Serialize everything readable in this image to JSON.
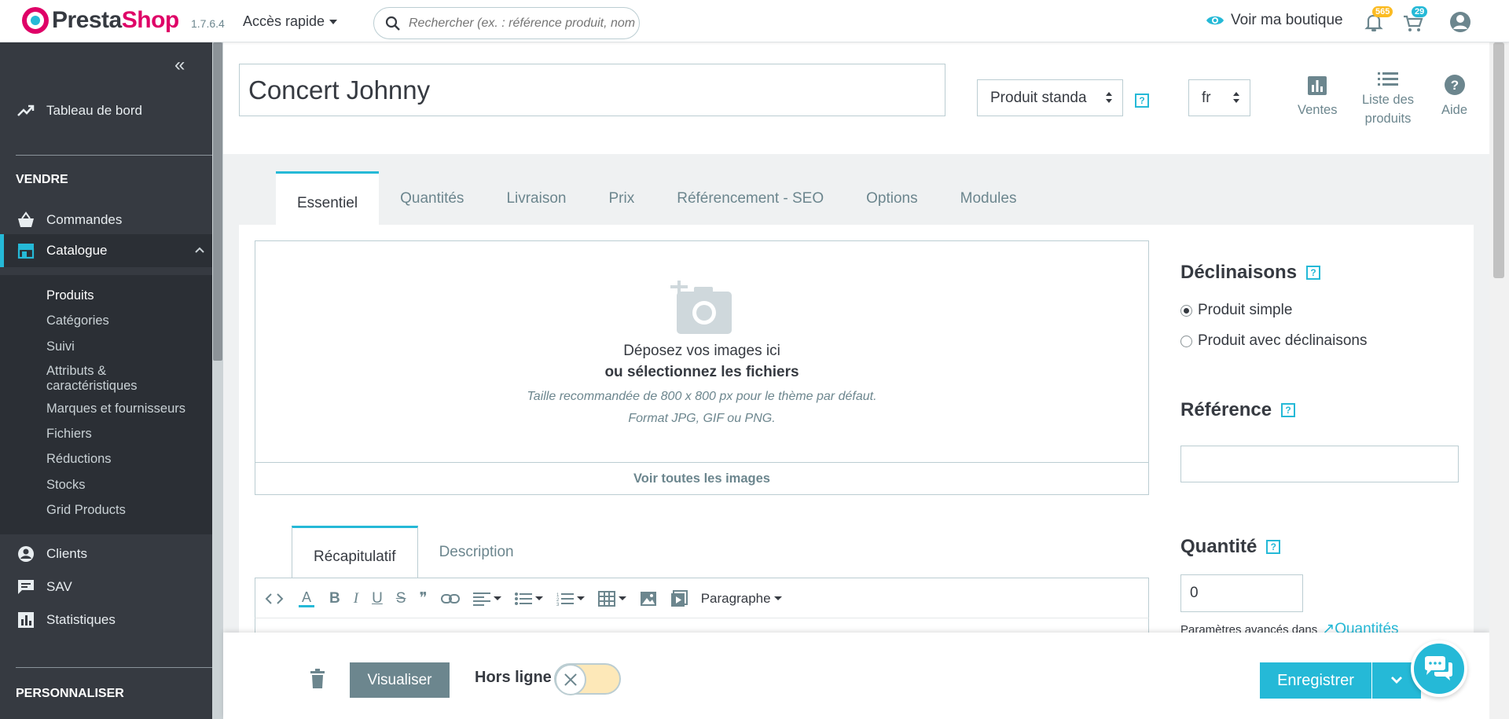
{
  "header": {
    "brand_pre": "Presta",
    "brand_post": "Shop",
    "version": "1.7.6.4",
    "quick_access": "Accès rapide",
    "search_placeholder": "Rechercher (ex. : référence produit, nom",
    "view_shop": "Voir ma boutique",
    "notifications_badge": "565",
    "orders_badge": "29"
  },
  "sidebar": {
    "collapse_icon": "«",
    "dashboard": "Tableau de bord",
    "section_sell": "VENDRE",
    "orders": "Commandes",
    "catalog": "Catalogue",
    "catalog_sub": [
      "Produits",
      "Catégories",
      "Suivi",
      "Attributs &",
      "caractéristiques",
      "Marques et fournisseurs",
      "Fichiers",
      "Réductions",
      "Stocks",
      "Grid Products"
    ],
    "customers": "Clients",
    "support": "SAV",
    "stats": "Statistiques",
    "section_customize": "PERSONNALISER"
  },
  "toolbar": {
    "product_name": "Concert Johnny",
    "product_type": "Produit standa",
    "help_mark": "?",
    "language": "fr",
    "sales": "Ventes",
    "product_list_1": "Liste des",
    "product_list_2": "produits",
    "help": "Aide"
  },
  "tabs": [
    "Essentiel",
    "Quantités",
    "Livraison",
    "Prix",
    "Référencement - SEO",
    "Options",
    "Modules"
  ],
  "dropzone": {
    "line1": "Déposez vos images ici",
    "line2": "ou sélectionnez les fichiers",
    "line3": "Taille recommandée de 800 x 800 px pour le thème par défaut.",
    "line4": "Format JPG, GIF ou PNG.",
    "footer": "Voir toutes les images"
  },
  "subtabs": [
    "Récapitulatif",
    "Description"
  ],
  "editor": {
    "paragraph": "Paragraphe"
  },
  "right_column": {
    "combinations_title": "Déclinaisons",
    "simple_product": "Produit simple",
    "with_combinations": "Produit avec déclinaisons",
    "reference_title": "Référence",
    "reference_value": "",
    "quantity_title": "Quantité",
    "quantity_value": "0",
    "advanced_params": "Paramètres avancés dans",
    "quantities_link": "Quantités"
  },
  "footer": {
    "preview": "Visualiser",
    "offline": "Hors ligne",
    "save": "Enregistrer"
  },
  "colors": {
    "accent": "#25b9d7",
    "brand_pink": "#df0067",
    "sidebar_bg": "#363a41",
    "text": "#363a41",
    "muted": "#6c868e"
  }
}
